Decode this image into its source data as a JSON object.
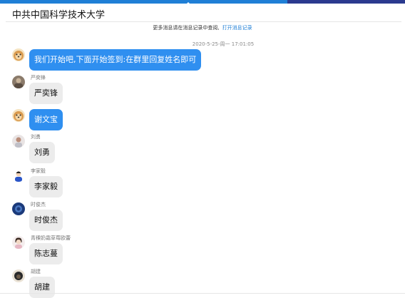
{
  "window": {
    "title": "中共中国科学技术大学"
  },
  "notice": {
    "text": "更多消息请在消息记录中查阅,",
    "link": "打开消息记录"
  },
  "timestamp": "2020-5-25-周一 17:01:05",
  "messages": [
    {
      "sender": "",
      "text": "我们开始吧,下面开始签到:在群里回复姓名即可",
      "self": true,
      "avatar": "dog-avatar"
    },
    {
      "sender": "严奕锋",
      "text": "严奕锋",
      "self": false,
      "avatar": "photo-avatar"
    },
    {
      "sender": "",
      "text": "谢文宝",
      "self": true,
      "avatar": "dog-avatar"
    },
    {
      "sender": "刘勇",
      "text": "刘勇",
      "self": false,
      "avatar": "photo-avatar"
    },
    {
      "sender": "李家毅",
      "text": "李家毅",
      "self": false,
      "avatar": "cartoon-avatar"
    },
    {
      "sender": "时俊杰",
      "text": "时俊杰",
      "self": false,
      "avatar": "blue-avatar"
    },
    {
      "sender": "青稞奶霜草莓欧蕾",
      "text": "陈志蔓",
      "self": false,
      "avatar": "girl-avatar"
    },
    {
      "sender": "胡建",
      "text": "胡建",
      "self": false,
      "avatar": "dark-avatar"
    }
  ]
}
